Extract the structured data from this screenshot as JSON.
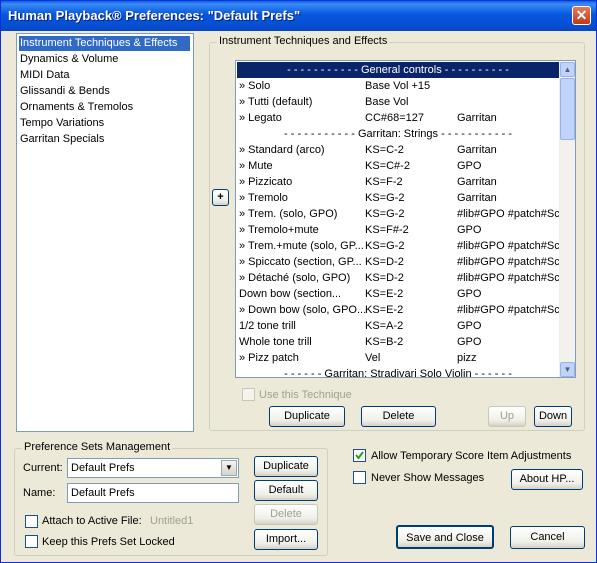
{
  "window": {
    "title": "Human Playback® Preferences: \"Default Prefs\"",
    "close_glyph": "✕"
  },
  "categories": [
    "Instrument Techniques & Effects",
    "Dynamics & Volume",
    "MIDI Data",
    "Glissandi & Bends",
    "Ornaments & Tremolos",
    "Tempo Variations",
    "Garritan Specials"
  ],
  "techniques": {
    "group_label": "Instrument Techniques and Effects",
    "header": "- - - - - - - - - - - General controls - - - - - - - - - -",
    "rows": [
      {
        "name": "» Solo",
        "value": "Base Vol +15",
        "extra": ""
      },
      {
        "name": "» Tutti (default)",
        "value": "Base Vol",
        "extra": ""
      },
      {
        "name": "» Legato",
        "value": "CC#68=127",
        "extra": "Garritan"
      },
      {
        "sep": "- - - - - - - - - - - Garritan: Strings - - - - - - - - - - -"
      },
      {
        "name": "» Standard (arco)",
        "value": "KS=C-2",
        "extra": "Garritan"
      },
      {
        "name": "» Mute",
        "value": "KS=C#-2",
        "extra": "GPO"
      },
      {
        "name": "» Pizzicato",
        "value": "KS=F-2",
        "extra": "Garritan"
      },
      {
        "name": "» Tremolo",
        "value": "KS=G-2",
        "extra": "Garritan"
      },
      {
        "name": "» Trem. (solo, GPO)",
        "value": "KS=G-2",
        "extra": "#lib#GPO #patch#Sc"
      },
      {
        "name": "» Tremolo+mute",
        "value": "KS=F#-2",
        "extra": "GPO"
      },
      {
        "name": "» Trem.+mute (solo, GP...",
        "value": "KS=G-2",
        "extra": "#lib#GPO #patch#Sc"
      },
      {
        "name": "» Spiccato (section, GP...",
        "value": "KS=D-2",
        "extra": "#lib#GPO #patch#Sc"
      },
      {
        "name": "» Détaché (solo, GPO)",
        "value": "KS=D-2",
        "extra": "#lib#GPO #patch#Sc"
      },
      {
        "name": "  Down bow (section...",
        "value": "KS=E-2",
        "extra": "GPO"
      },
      {
        "name": "» Down bow (solo, GPO...",
        "value": "KS=E-2",
        "extra": "#lib#GPO #patch#Sc"
      },
      {
        "name": "  1/2 tone trill",
        "value": "KS=A-2",
        "extra": "GPO"
      },
      {
        "name": "  Whole tone trill",
        "value": "KS=B-2",
        "extra": "GPO"
      },
      {
        "name": "» Pizz patch",
        "value": "Vel",
        "extra": "pizz"
      },
      {
        "sep": "- - - - - - Garritan: Stradivari Solo Violin - - - - - -"
      }
    ],
    "plus_label": "+",
    "use_technique_label": "Use this Technique",
    "duplicate_label": "Duplicate",
    "delete_label": "Delete",
    "up_label": "Up",
    "down_label": "Down"
  },
  "prefsets": {
    "group_label": "Preference Sets Management",
    "current_label": "Current:",
    "current_value": "Default Prefs",
    "name_label": "Name:",
    "name_value": "Default Prefs",
    "attach_label": "Attach to Active File:",
    "attach_file": "Untitled1",
    "locked_label": "Keep this Prefs Set Locked",
    "duplicate_label": "Duplicate",
    "default_label": "Default",
    "delete_label": "Delete",
    "import_label": "Import..."
  },
  "options": {
    "allow_temp_label": "Allow Temporary Score Item Adjustments",
    "allow_temp_checked": true,
    "never_show_label": "Never Show Messages",
    "never_show_checked": false,
    "about_label": "About HP..."
  },
  "footer": {
    "save_label": "Save and Close",
    "cancel_label": "Cancel"
  }
}
